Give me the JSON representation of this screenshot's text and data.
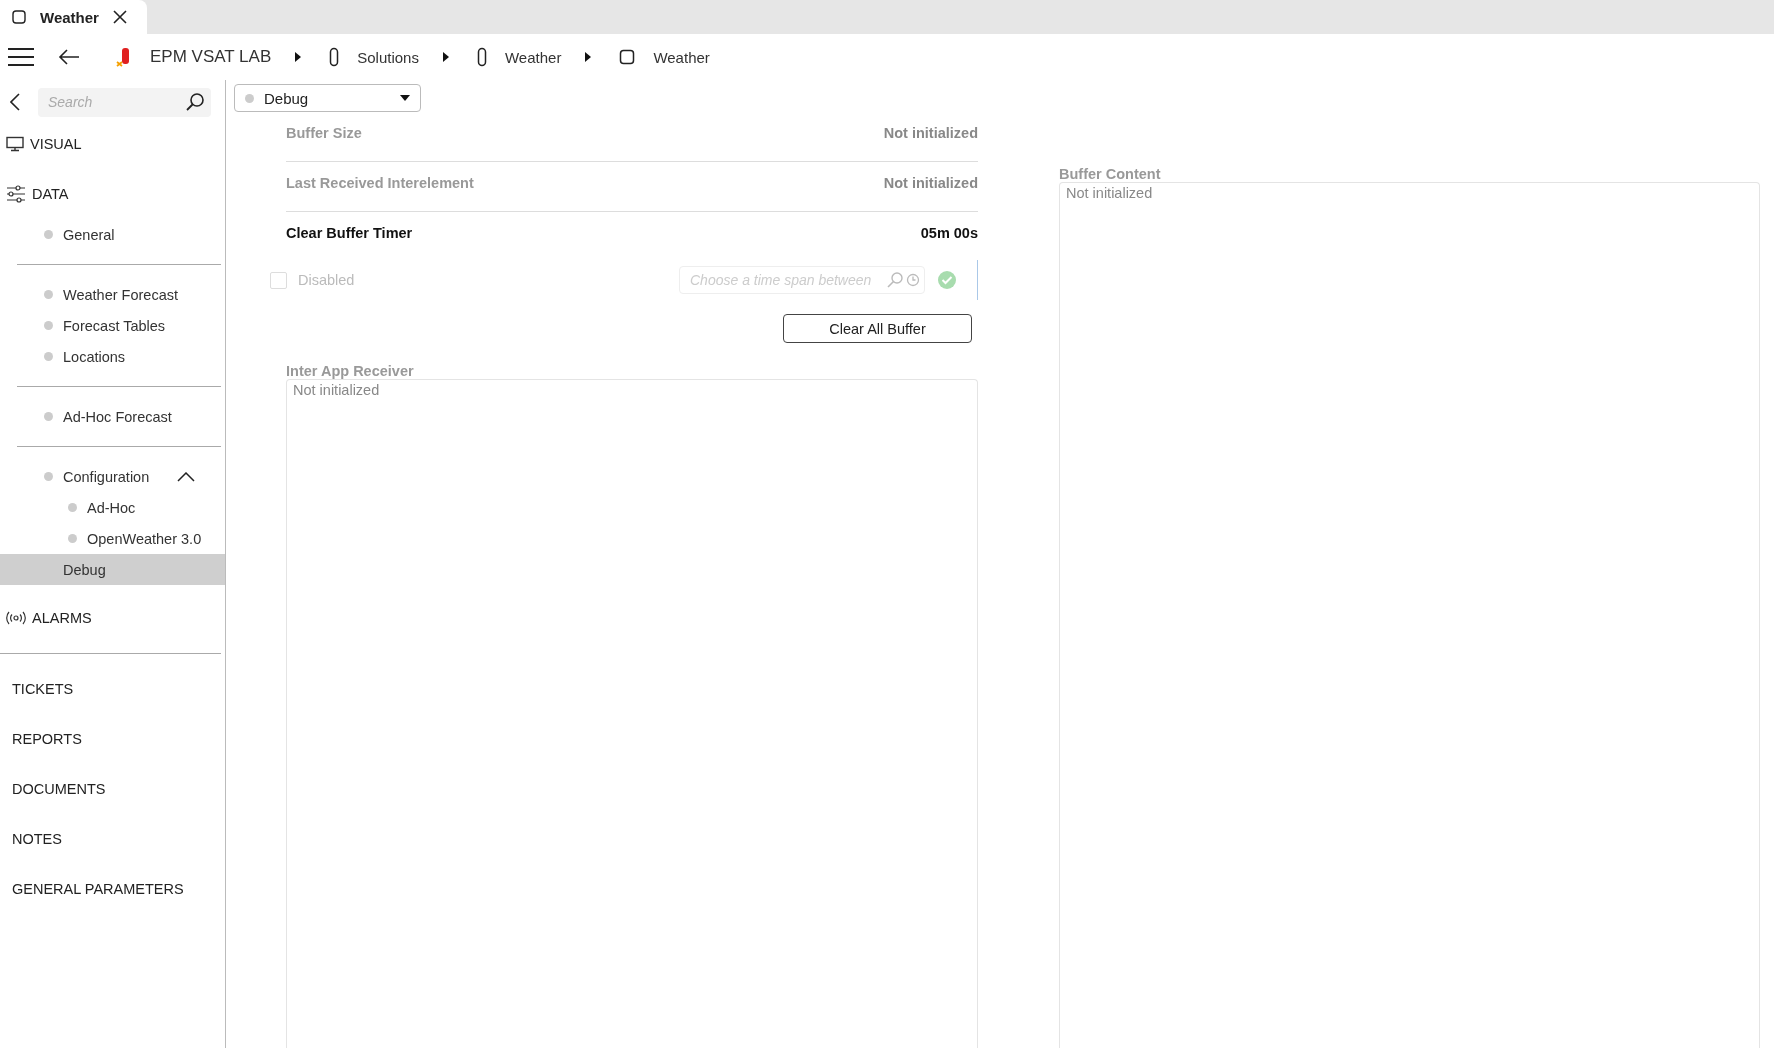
{
  "tab": {
    "title": "Weather",
    "selected": true
  },
  "breadcrumb": [
    {
      "label": "EPM VSAT LAB",
      "kind": "site"
    },
    {
      "label": "Solutions",
      "kind": "folder"
    },
    {
      "label": "Weather",
      "kind": "folder"
    },
    {
      "label": "Weather",
      "kind": "page"
    }
  ],
  "sidebar": {
    "search": {
      "placeholder": "Search"
    },
    "sections": [
      {
        "label": "VISUAL",
        "kind": "display"
      },
      {
        "label": "DATA",
        "kind": "data",
        "groups": [
          [
            {
              "label": "General",
              "selected": false
            }
          ],
          [
            {
              "label": "Weather Forecast",
              "selected": false
            },
            {
              "label": "Forecast Tables",
              "selected": false
            },
            {
              "label": "Locations",
              "selected": false
            }
          ],
          [
            {
              "label": "Ad-Hoc Forecast",
              "selected": false
            }
          ],
          [
            {
              "label": "Configuration",
              "selected": false,
              "expanded": true,
              "children": [
                {
                  "label": "Ad-Hoc",
                  "selected": false
                },
                {
                  "label": "OpenWeather 3.0",
                  "selected": false
                }
              ]
            },
            {
              "label": "Debug",
              "selected": true
            }
          ]
        ]
      },
      {
        "label": "ALARMS",
        "kind": "alarms"
      }
    ],
    "links": [
      "TICKETS",
      "REPORTS",
      "DOCUMENTS",
      "NOTES",
      "GENERAL PARAMETERS"
    ]
  },
  "view_select": {
    "value": "Debug"
  },
  "fields": [
    {
      "label": "Buffer Size",
      "value": "Not initialized",
      "enabled": false
    },
    {
      "label": "Last Received Interelement",
      "value": "Not initialized",
      "enabled": false
    },
    {
      "label": "Clear Buffer Timer",
      "value": "05m 00s",
      "enabled": true
    }
  ],
  "timer_options": {
    "checkbox": {
      "label": "Disabled",
      "checked": false,
      "disabled": true
    },
    "time_field": {
      "placeholder": "Choose a time span between"
    }
  },
  "clear_button": "Clear All Buffer",
  "inter_app_receiver": {
    "label": "Inter App Receiver",
    "value": "Not initialized"
  },
  "buffer_content": {
    "label": "Buffer Content",
    "value": "Not initialized"
  }
}
